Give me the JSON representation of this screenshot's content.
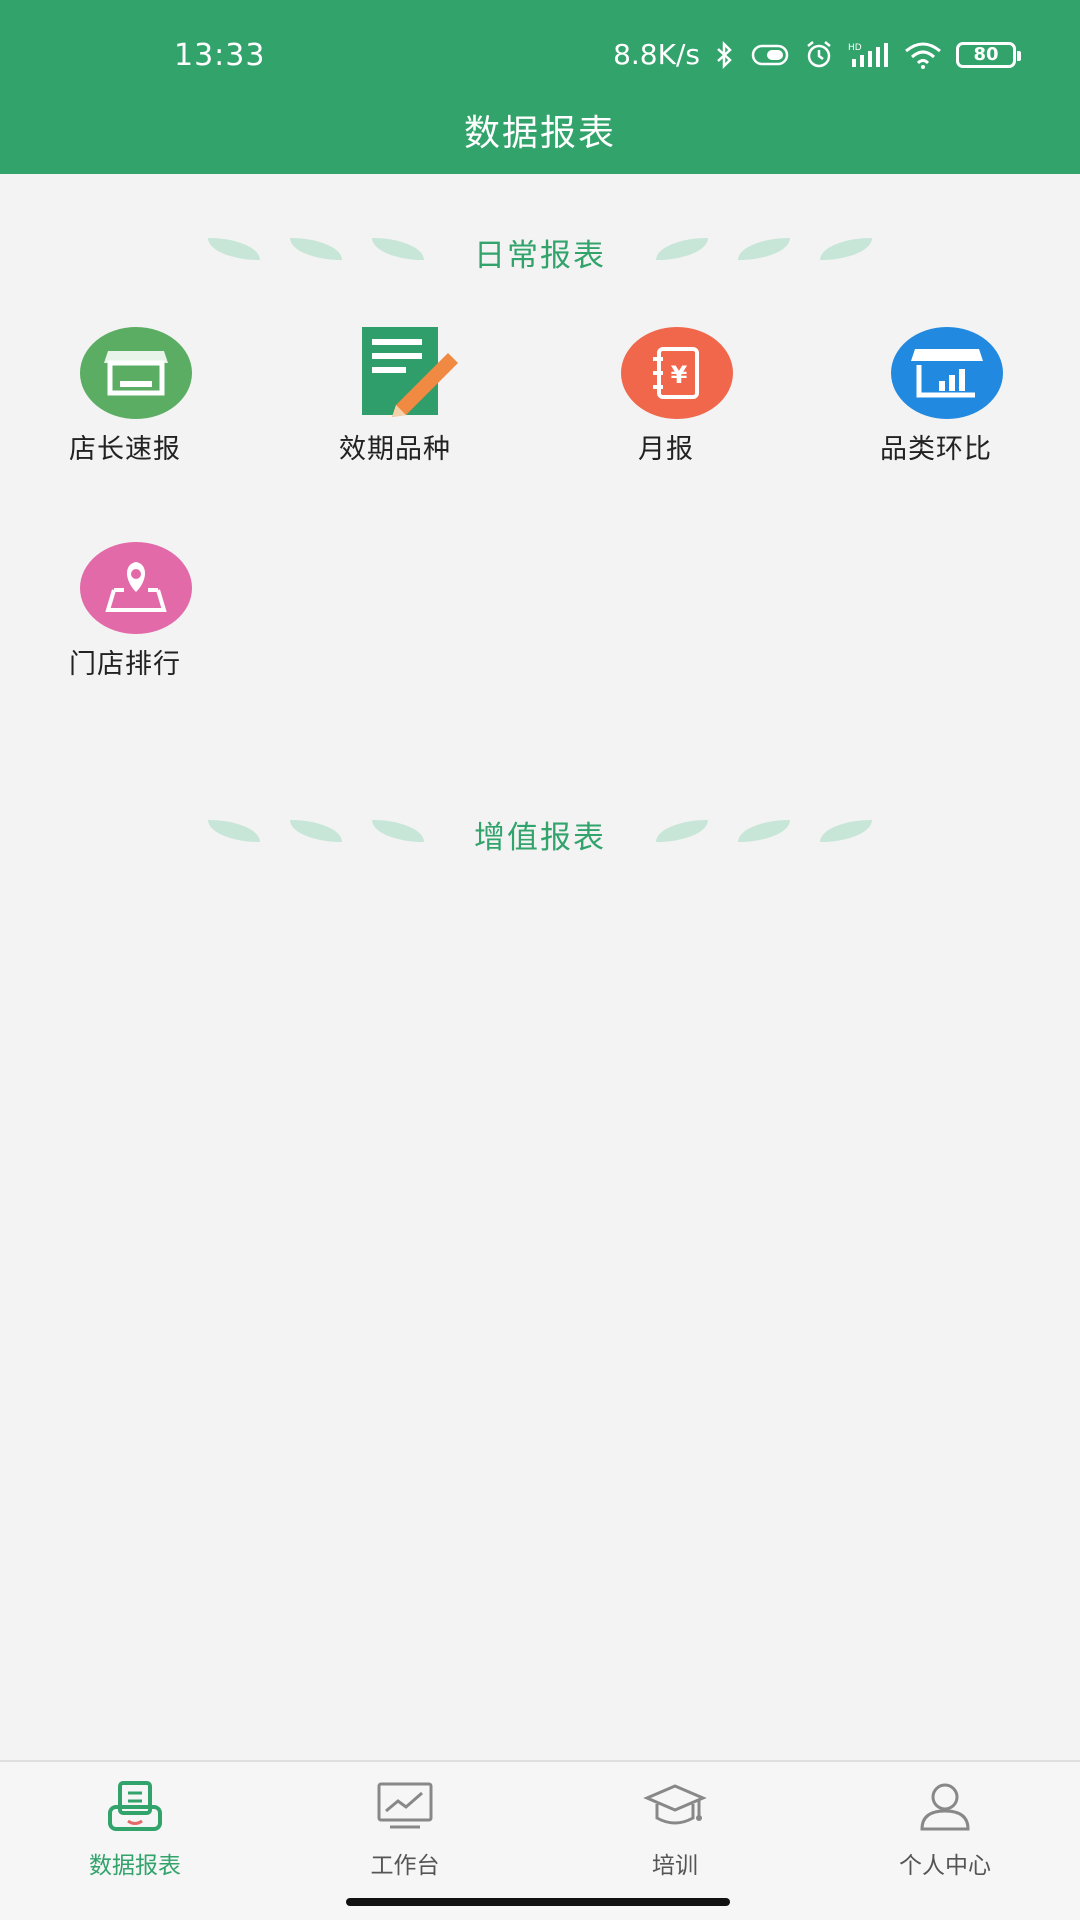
{
  "status_bar": {
    "time": "13:33",
    "network_speed": "8.8K/s",
    "battery_level": "80",
    "icons": [
      "bluetooth-icon",
      "vibrate-icon",
      "alarm-icon",
      "hd-signal-icon",
      "wifi-icon",
      "battery-icon"
    ]
  },
  "header": {
    "title": "数据报表"
  },
  "sections": {
    "daily": {
      "title": "日常报表",
      "items": [
        {
          "label": "店长速报",
          "icon": "storefront-icon",
          "color": "#5aad62"
        },
        {
          "label": "效期品种",
          "icon": "notepad-pencil-icon",
          "color": "#2f9e6b"
        },
        {
          "label": "月报",
          "icon": "ledger-yen-icon",
          "color": "#f0674b"
        },
        {
          "label": "品类环比",
          "icon": "store-chart-icon",
          "color": "#2289e0"
        },
        {
          "label": "门店排行",
          "icon": "map-pin-icon",
          "color": "#e36aa8"
        }
      ]
    },
    "value_added": {
      "title": "增值报表"
    }
  },
  "bottom_nav": {
    "items": [
      {
        "label": "数据报表",
        "icon": "report-icon",
        "active": true
      },
      {
        "label": "工作台",
        "icon": "monitor-chart-icon",
        "active": false
      },
      {
        "label": "培训",
        "icon": "graduation-cap-icon",
        "active": false
      },
      {
        "label": "个人中心",
        "icon": "user-icon",
        "active": false
      }
    ]
  },
  "colors": {
    "brand_green": "#33a36c",
    "leaf": "#c7e6d8",
    "background": "#f3f3f3"
  }
}
